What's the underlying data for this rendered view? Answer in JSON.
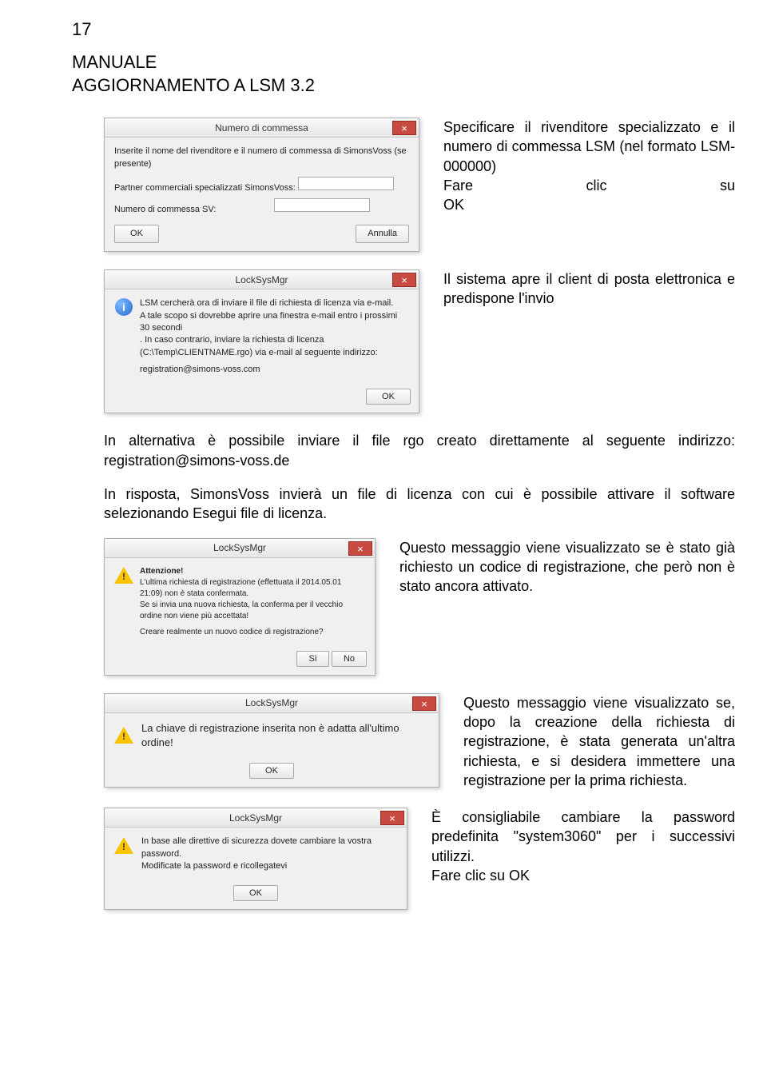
{
  "page": {
    "number": "17",
    "title_line1": "MANUALE",
    "title_line2": "AGGIORNAMENTO A LSM 3.2"
  },
  "para1": {
    "line1": "Specificare il rivenditore specializzato e il numero di commessa LSM (nel formato LSM-000000)",
    "fare": "Fare",
    "clic": "clic",
    "su": "su",
    "ok": "OK"
  },
  "para2": "Il sistema apre il client di posta elettronica e predispone l'invio",
  "para3": "In alternativa è possibile inviare il file rgo creato direttamente al seguente indirizzo: registration@simons-voss.de",
  "para4": "In risposta, SimonsVoss invierà un file di licenza con cui è possibile attivare il software selezionando Esegui file di licenza.",
  "para5": "Questo messaggio viene visualizzato se è stato già richiesto un codice di registrazione, che però non è stato ancora attivato.",
  "para6": "Questo messaggio viene visualizzato se, dopo la creazione della richiesta di registrazione, è stata generata un'altra richiesta, e si desidera immettere una registrazione per la prima richiesta.",
  "para7_line1": "È consigliabile cambiare la password predefinita \"system3060\" per i successivi utilizzi.",
  "para7_line2": "Fare clic su OK",
  "dlg1": {
    "title": "Numero di commessa",
    "body": "Inserite il nome del rivenditore e il numero di commessa di SimonsVoss (se presente)",
    "label1": "Partner commerciali specializzati SimonsVoss:",
    "label2": "Numero di commessa SV:",
    "ok": "OK",
    "cancel": "Annulla"
  },
  "dlg2": {
    "title": "LockSysMgr",
    "body1": "LSM cercherà ora di inviare il file di richiesta di licenza via e-mail.",
    "body2": "A tale scopo si dovrebbe aprire una finestra e-mail entro i prossimi 30 secondi",
    "body3": ". In caso contrario, inviare la richiesta di licenza (C:\\Temp\\CLIENTNAME.rgo) via e-mail al seguente indirizzo:",
    "email": "registration@simons-voss.com",
    "ok": "OK"
  },
  "dlg3": {
    "title": "LockSysMgr",
    "heading": "Attenzione!",
    "body1": "L'ultima richiesta di registrazione (effettuata il 2014.05.01 21:09) non è stata confermata.",
    "body2": "Se si invia una nuova richiesta, la conferma per il vecchio ordine non viene più accettata!",
    "body3": "Creare realmente un nuovo codice di registrazione?",
    "yes": "Sì",
    "no": "No"
  },
  "dlg4": {
    "title": "LockSysMgr",
    "body": "La chiave di registrazione inserita non è adatta all'ultimo ordine!",
    "ok": "OK"
  },
  "dlg5": {
    "title": "LockSysMgr",
    "body1": "In base alle direttive di sicurezza dovete cambiare la vostra password.",
    "body2": "Modificate la password e ricollegatevi",
    "ok": "OK"
  }
}
